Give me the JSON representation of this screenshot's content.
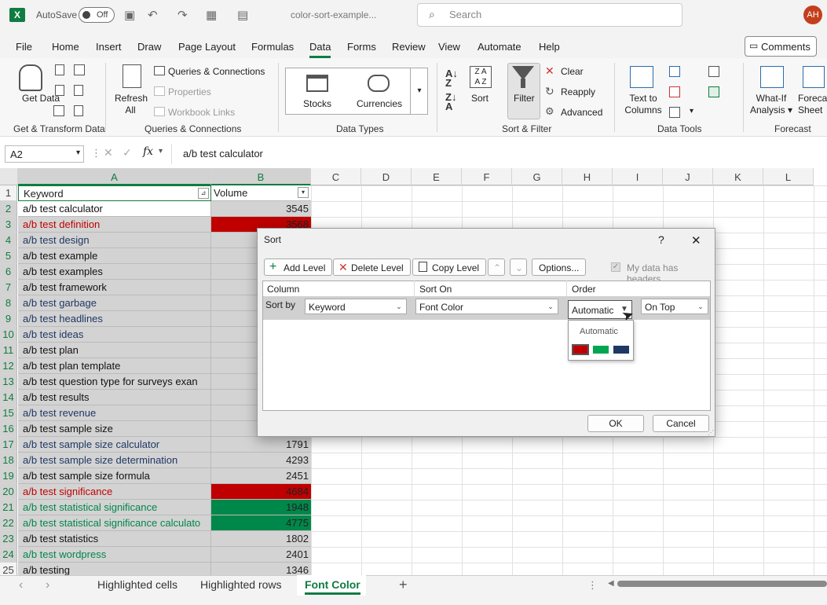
{
  "titlebar": {
    "autosave_label": "AutoSave",
    "autosave_state": "Off",
    "filename": "color-sort-example...",
    "search_placeholder": "Search",
    "user_initials": "AH"
  },
  "menu": {
    "items": [
      "File",
      "Home",
      "Insert",
      "Draw",
      "Page Layout",
      "Formulas",
      "Data",
      "Forms",
      "Review",
      "View",
      "Automate",
      "Help"
    ],
    "active": "Data",
    "comments_label": "Comments"
  },
  "ribbon": {
    "get_data": "Get Data",
    "refresh_all": "Refresh All",
    "queries_connections": "Queries & Connections",
    "properties": "Properties",
    "workbook_links": "Workbook Links",
    "stocks": "Stocks",
    "currencies": "Currencies",
    "sort": "Sort",
    "filter": "Filter",
    "clear": "Clear",
    "reapply": "Reapply",
    "advanced": "Advanced",
    "text_to_columns_1": "Text to",
    "text_to_columns_2": "Columns",
    "what_if_1": "What-If",
    "what_if_2": "Analysis",
    "forecast_1": "Foreca",
    "forecast_2": "Sheet",
    "groups": {
      "get_transform": "Get & Transform Data",
      "queries": "Queries & Connections",
      "data_types": "Data Types",
      "sort_filter": "Sort & Filter",
      "data_tools": "Data Tools",
      "forecast": "Forecast"
    }
  },
  "formula_bar": {
    "name_box": "A2",
    "fx": "fx",
    "value": "a/b test calculator"
  },
  "grid": {
    "columns": [
      "A",
      "B",
      "C",
      "D",
      "E",
      "F",
      "G",
      "H",
      "I",
      "J",
      "K",
      "L"
    ],
    "header_row": {
      "a": "Keyword",
      "b": "Volume"
    },
    "rows": [
      {
        "n": "2",
        "a": "a/b test calculator",
        "b": "3545",
        "fc": "#111111",
        "bf": ""
      },
      {
        "n": "3",
        "a": "a/b test definition",
        "b": "3568",
        "fc": "#c00000",
        "bf": "#c00000"
      },
      {
        "n": "4",
        "a": "a/b test design",
        "b": "",
        "fc": "#1f3864",
        "bf": ""
      },
      {
        "n": "5",
        "a": "a/b test example",
        "b": "",
        "fc": "#111111",
        "bf": ""
      },
      {
        "n": "6",
        "a": "a/b test examples",
        "b": "",
        "fc": "#111111",
        "bf": ""
      },
      {
        "n": "7",
        "a": "a/b test framework",
        "b": "",
        "fc": "#111111",
        "bf": ""
      },
      {
        "n": "8",
        "a": "a/b test garbage",
        "b": "",
        "fc": "#1f3864",
        "bf": ""
      },
      {
        "n": "9",
        "a": "a/b test headlines",
        "b": "",
        "fc": "#1f3864",
        "bf": ""
      },
      {
        "n": "10",
        "a": "a/b test ideas",
        "b": "",
        "fc": "#1f3864",
        "bf": ""
      },
      {
        "n": "11",
        "a": "a/b test plan",
        "b": "",
        "fc": "#111111",
        "bf": ""
      },
      {
        "n": "12",
        "a": "a/b test plan template",
        "b": "",
        "fc": "#111111",
        "bf": ""
      },
      {
        "n": "13",
        "a": "a/b test question type for surveys exan",
        "b": "",
        "fc": "#111111",
        "bf": ""
      },
      {
        "n": "14",
        "a": "a/b test results",
        "b": "",
        "fc": "#111111",
        "bf": ""
      },
      {
        "n": "15",
        "a": "a/b test revenue",
        "b": "",
        "fc": "#1f3864",
        "bf": ""
      },
      {
        "n": "16",
        "a": "a/b test sample size",
        "b": "",
        "fc": "#111111",
        "bf": ""
      },
      {
        "n": "17",
        "a": "a/b test sample size calculator",
        "b": "1791",
        "fc": "#1f3864",
        "bf": ""
      },
      {
        "n": "18",
        "a": "a/b test sample size determination",
        "b": "4293",
        "fc": "#1f3864",
        "bf": ""
      },
      {
        "n": "19",
        "a": "a/b test sample size formula",
        "b": "2451",
        "fc": "#111111",
        "bf": ""
      },
      {
        "n": "20",
        "a": "a/b test significance",
        "b": "4684",
        "fc": "#c00000",
        "bf": "#c00000"
      },
      {
        "n": "21",
        "a": "a/b test statistical significance",
        "b": "1948",
        "fc": "#00874a",
        "bf": "#00874a"
      },
      {
        "n": "22",
        "a": "a/b test statistical significance calculato",
        "b": "4775",
        "fc": "#00874a",
        "bf": "#00874a"
      },
      {
        "n": "23",
        "a": "a/b test statistics",
        "b": "1802",
        "fc": "#111111",
        "bf": ""
      },
      {
        "n": "24",
        "a": "a/b test wordpress",
        "b": "2401",
        "fc": "#00874a",
        "bf": ""
      },
      {
        "n": "25",
        "a": "a/b testing",
        "b": "1346",
        "fc": "#111111",
        "bf": ""
      }
    ]
  },
  "sort_dialog": {
    "title": "Sort",
    "help": "?",
    "close": "✕",
    "add_level": "Add Level",
    "delete_level": "Delete Level",
    "copy_level": "Copy Level",
    "options": "Options...",
    "my_data_has_headers": "My data has headers",
    "headers_checked": true,
    "col_header_column": "Column",
    "col_header_sort_on": "Sort On",
    "col_header_order": "Order",
    "sort_by": "Sort by",
    "column_value": "Keyword",
    "sort_on_value": "Font Color",
    "order_value": "Automatic",
    "position_value": "On Top",
    "ok": "OK",
    "cancel": "Cancel",
    "color_menu": {
      "automatic": "Automatic",
      "swatches": [
        "#c00000",
        "#00a651",
        "#1f3864"
      ]
    }
  },
  "sheet_tabs": {
    "tabs": [
      "Highlighted cells",
      "Highlighted rows",
      "Font Color"
    ],
    "active": "Font Color",
    "add": "+"
  },
  "colors": {
    "excel_green": "#107c41",
    "annotation_arrow": "#d21e1e"
  }
}
